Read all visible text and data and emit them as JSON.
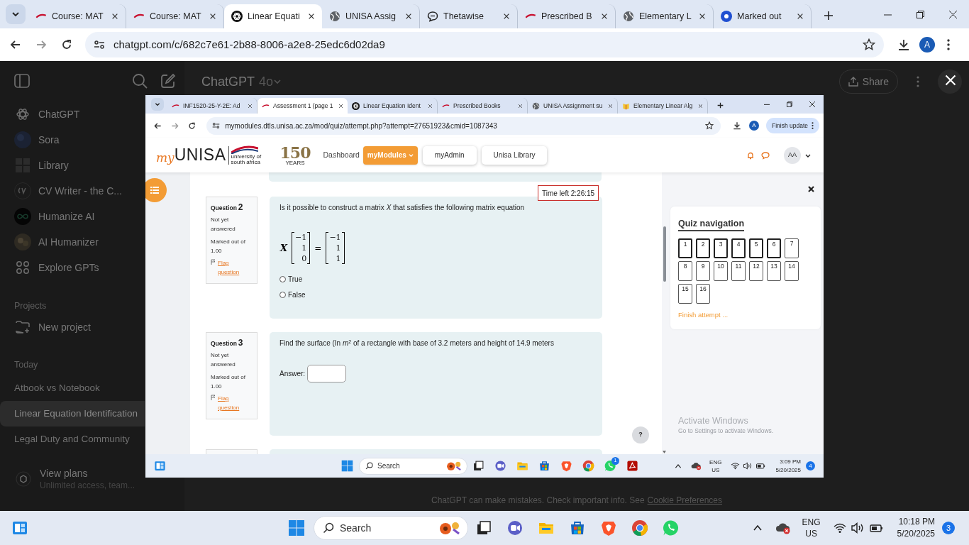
{
  "browser": {
    "tabs": [
      {
        "label": "Course: MAT",
        "selected": false
      },
      {
        "label": "Course: MAT",
        "selected": false
      },
      {
        "label": "Linear Equati",
        "selected": true
      },
      {
        "label": "UNISA Assig",
        "selected": false
      },
      {
        "label": "Thetawise",
        "selected": false
      },
      {
        "label": "Prescribed B",
        "selected": false
      },
      {
        "label": "Elementary L",
        "selected": false
      },
      {
        "label": "Marked out",
        "selected": false
      }
    ],
    "url": "chatgpt.com/c/682c7e61-2b88-8006-a2e8-25edc6d02da9",
    "avatar": "A"
  },
  "chatgpt": {
    "header": {
      "title": "ChatGPT",
      "model": "4o",
      "share": "Share"
    },
    "sidebar": {
      "items": [
        {
          "label": "ChatGPT"
        },
        {
          "label": "Sora"
        },
        {
          "label": "Library"
        },
        {
          "label": "CV Writer - the C..."
        },
        {
          "label": "Humanize AI"
        },
        {
          "label": "AI Humanizer"
        },
        {
          "label": "Explore GPTs"
        }
      ],
      "projects_heading": "Projects",
      "new_project": "New project",
      "today_heading": "Today",
      "chats": [
        {
          "title": "Atbook vs Notebook",
          "selected": false
        },
        {
          "title": "Linear Equation Identification",
          "selected": true
        },
        {
          "title": "Legal Duty and Community",
          "selected": false
        }
      ],
      "plan": {
        "title": "View plans",
        "subtitle": "Unlimited access, team..."
      }
    },
    "footer": {
      "text": "ChatGPT can make mistakes. Check important info. See",
      "link": "Cookie Preferences"
    }
  },
  "image_viewer": {
    "screenshot": {
      "browser": {
        "tabs": [
          {
            "label": "INF1520-25-Y-2E: Ad",
            "selected": false
          },
          {
            "label": "Assessment 1 (page 1",
            "selected": true
          },
          {
            "label": "Linear Equation Ident",
            "selected": false
          },
          {
            "label": "Prescribed Books",
            "selected": false
          },
          {
            "label": "UNISA Assignment su",
            "selected": false
          },
          {
            "label": "Elementary Linear Alg",
            "selected": false
          }
        ],
        "url": "mymodules.dtls.unisa.ac.za/mod/quiz/attempt.php?attempt=27651923&cmid=1087343",
        "avatar": "A",
        "update_button": "Finish update"
      },
      "site": {
        "logo": {
          "my": "my",
          "name": "UNISA",
          "tagline": "university of south africa",
          "anniversary": "150",
          "years": "YEARS"
        },
        "nav": [
          {
            "label": "Dashboard",
            "kind": "link",
            "selected": false
          },
          {
            "label": "myModules",
            "kind": "menu",
            "selected": true
          },
          {
            "label": "myAdmin",
            "kind": "pill",
            "selected": false
          },
          {
            "label": "Unisa Library",
            "kind": "pill",
            "selected": false
          }
        ],
        "user_initials": "AA"
      },
      "timer": "Time left 2:26:15",
      "questions": [
        {
          "label": "Question",
          "number": "2",
          "status": "Not yet answered",
          "marks": "Marked out of 1.00",
          "flag": "Flag question",
          "kind": "truefalse",
          "text": "Is it possible to construct a matrix *X* that satisfies the following matrix equation",
          "equation": {
            "symbol": "X",
            "lhs": [
              "−1",
              "1",
              "0"
            ],
            "operator": "=",
            "rhs": [
              "−1",
              "1",
              "1"
            ]
          },
          "options": [
            {
              "label": "True",
              "selected": false
            },
            {
              "label": "False",
              "selected": false
            }
          ]
        },
        {
          "label": "Question",
          "number": "3",
          "status": "Not yet answered",
          "marks": "Marked out of 1.00",
          "flag": "Flag question",
          "kind": "numeric",
          "text": "Find the surface (In *m*$^{2}$ of a rectangle with base of 3.2 meters and height of 14.9 meters",
          "answer_label": "Answer:"
        }
      ],
      "quiz_navigation": {
        "title": "Quiz navigation",
        "buttons": [
          {
            "label": "1",
            "current": true
          },
          {
            "label": "2",
            "current": true
          },
          {
            "label": "3",
            "current": true
          },
          {
            "label": "4",
            "current": true
          },
          {
            "label": "5",
            "current": true
          },
          {
            "label": "6",
            "current": true
          },
          {
            "label": "7",
            "current": false
          },
          {
            "label": "8",
            "current": false
          },
          {
            "label": "9",
            "current": false
          },
          {
            "label": "10",
            "current": false
          },
          {
            "label": "11",
            "current": false
          },
          {
            "label": "12",
            "current": false
          },
          {
            "label": "13",
            "current": false
          },
          {
            "label": "14",
            "current": false
          },
          {
            "label": "15",
            "current": false
          },
          {
            "label": "16",
            "current": false
          }
        ],
        "finish": "Finish attempt ..."
      },
      "help": "?",
      "activation": {
        "title": "Activate Windows",
        "text": "Go to Settings to activate Windows."
      },
      "taskbar": {
        "search": "Search",
        "language": "ENG",
        "region": "US",
        "time": "3:09 PM",
        "date": "5/20/2025",
        "whatsapp_badge": "1",
        "notifications": "4"
      }
    }
  },
  "taskbar": {
    "search": "Search",
    "language": "ENG",
    "region": "US",
    "time": "10:18 PM",
    "date": "5/20/2025",
    "notifications": "3"
  }
}
